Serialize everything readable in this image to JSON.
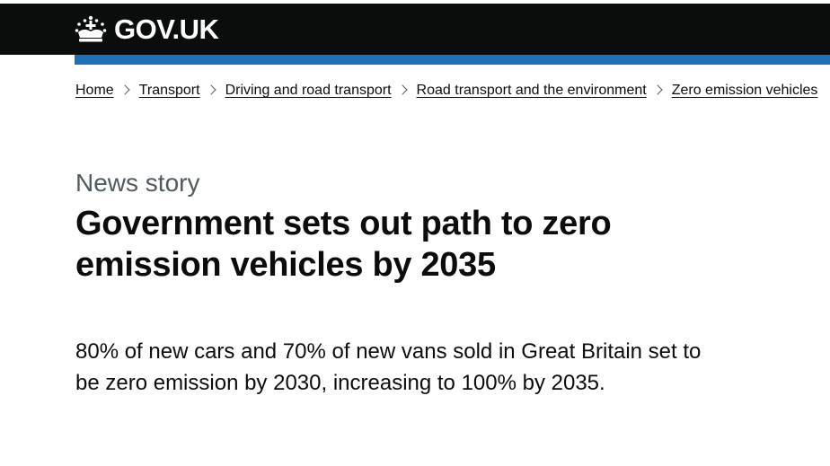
{
  "header": {
    "logo_text": "GOV.UK",
    "logo_icon": "crown-icon",
    "background": "#0b0c0c",
    "accent_bar_color": "#1d70b8"
  },
  "breadcrumbs": [
    {
      "label": "Home"
    },
    {
      "label": "Transport"
    },
    {
      "label": "Driving and road transport"
    },
    {
      "label": "Road transport and the environment"
    },
    {
      "label": "Zero emission vehicles"
    }
  ],
  "page": {
    "caption": "News story",
    "title": "Government sets out path to zero emission vehicles by 2035",
    "lead": "80% of new cars and 70% of new vans sold in Great Britain set to be zero emission by 2030, increasing to 100% by 2035."
  }
}
